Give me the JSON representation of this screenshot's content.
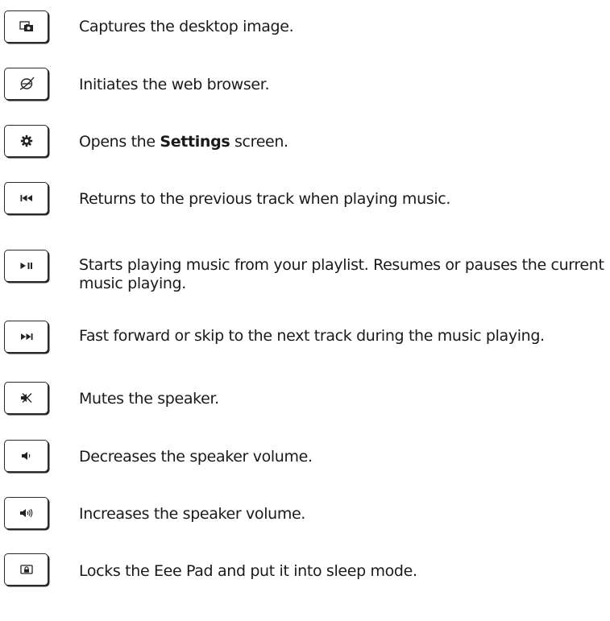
{
  "keys": [
    {
      "icon": "screenshot-icon",
      "text": "Captures the desktop image."
    },
    {
      "icon": "browser-icon",
      "text": "Initiates the web browser."
    },
    {
      "icon": "settings-gear-icon",
      "text_before": "Opens the ",
      "text_bold": "Settings",
      "text_after": " screen."
    },
    {
      "icon": "previous-track-icon",
      "text": "Returns to the previous track when playing music."
    },
    {
      "icon": "play-pause-icon",
      "text": "Starts playing music from your playlist. Resumes or pauses the current music playing."
    },
    {
      "icon": "next-track-icon",
      "text": "Fast forward or skip to the next track during the music playing."
    },
    {
      "icon": "mute-icon",
      "text": "Mutes the speaker."
    },
    {
      "icon": "volume-down-icon",
      "text": "Decreases the speaker volume."
    },
    {
      "icon": "volume-up-icon",
      "text": "Increases the speaker volume."
    },
    {
      "icon": "lock-sleep-icon",
      "text": "Locks the Eee Pad and put it into sleep mode."
    }
  ]
}
